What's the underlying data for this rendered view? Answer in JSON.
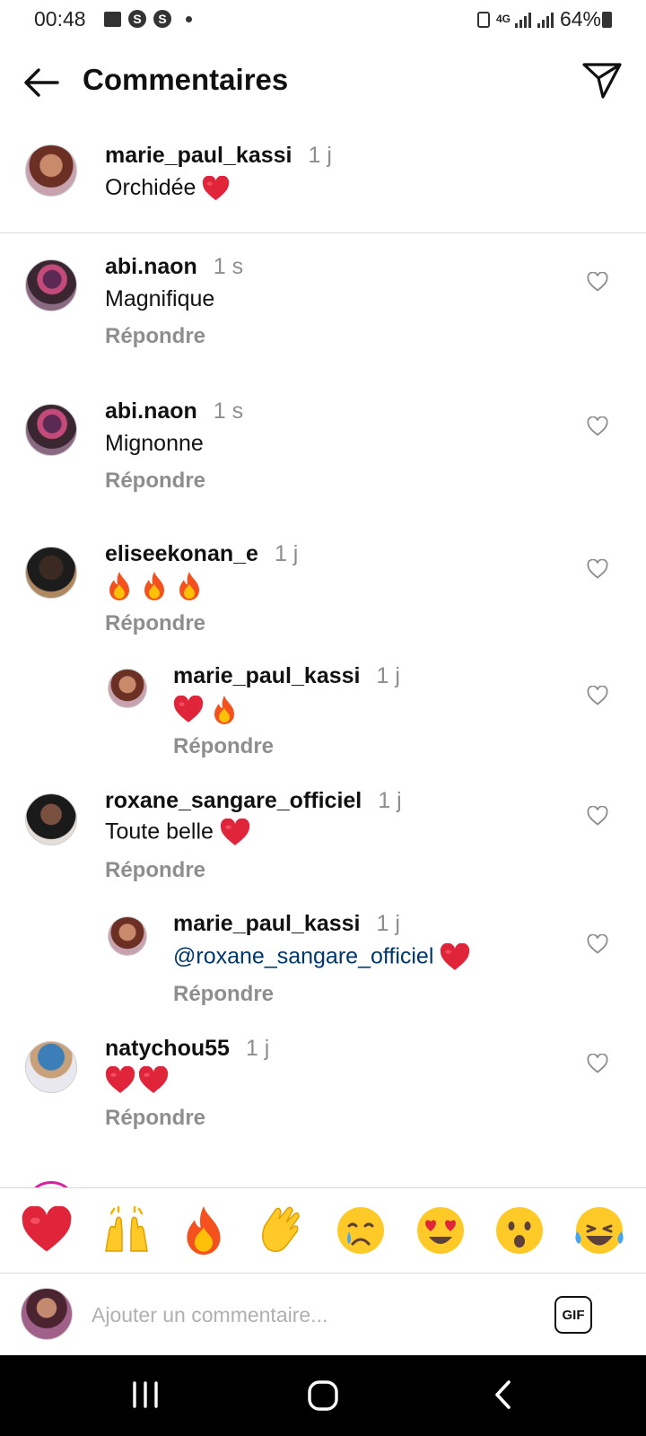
{
  "status": {
    "time": "00:48",
    "battery": "64%"
  },
  "header": {
    "title": "Commentaires"
  },
  "caption": {
    "user": "marie_paul_kassi",
    "time": "1 j",
    "text": "Orchidée"
  },
  "comments": [
    {
      "user": "abi.naon",
      "time": "1 s",
      "text": "Magnifique",
      "reply": "Répondre"
    },
    {
      "user": "abi.naon",
      "time": "1 s",
      "text": "Mignonne",
      "reply": "Répondre"
    },
    {
      "user": "eliseekonan_e",
      "time": "1 j",
      "text": "",
      "reply": "Répondre"
    },
    {
      "user": "marie_paul_kassi",
      "time": "1 j",
      "text": "",
      "reply": "Répondre"
    },
    {
      "user": "roxane_sangare_officiel",
      "time": "1 j",
      "text": "Toute belle",
      "reply": "Répondre"
    },
    {
      "user": "marie_paul_kassi",
      "time": "1 j",
      "text": "@roxane_sangare_officiel",
      "reply": "Répondre"
    },
    {
      "user": "natychou55",
      "time": "1 j",
      "text": "",
      "reply": "Répondre"
    }
  ],
  "emoji_bar": [
    "heart",
    "raising-hands",
    "fire",
    "clapping-hands",
    "crying-face",
    "heart-eyes",
    "surprised-face",
    "laughing-tears"
  ],
  "composer": {
    "placeholder": "Ajouter un commentaire...",
    "gif_label": "GIF"
  }
}
